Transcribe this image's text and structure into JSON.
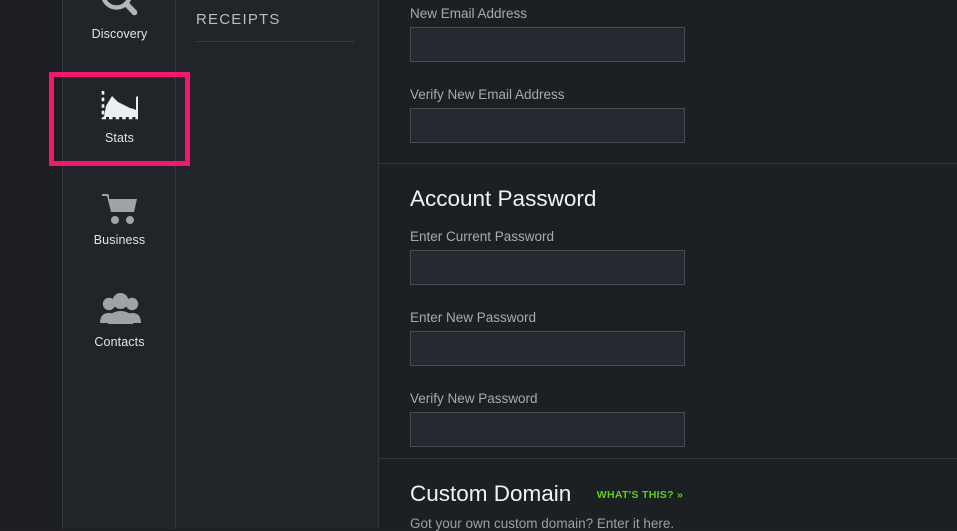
{
  "theme": {
    "page_bg": "#1e2024",
    "panel_bg": "#212428",
    "content_bg": "#1d2023",
    "divider": "#34383d",
    "highlight_pink": "#f5176e",
    "accent_green": "#5bce1f",
    "label_gray": "#a6abb0",
    "heading_white": "#f2f2f2"
  },
  "sidebar": {
    "items": [
      {
        "id": "discovery",
        "label": "Discovery",
        "icon": "magnifier-icon",
        "selected": false
      },
      {
        "id": "stats",
        "label": "Stats",
        "icon": "area-chart-icon",
        "selected": true
      },
      {
        "id": "business",
        "label": "Business",
        "icon": "shopping-cart-icon",
        "selected": false
      },
      {
        "id": "contacts",
        "label": "Contacts",
        "icon": "people-group-icon",
        "selected": false
      }
    ],
    "highlighted_item": "Stats"
  },
  "middle_column": {
    "heading": "RECEIPTS"
  },
  "content": {
    "sections": [
      {
        "id": "email",
        "title": "",
        "fields": [
          {
            "label": "New Email Address",
            "value": "",
            "placeholder": ""
          },
          {
            "label": "Verify New Email Address",
            "value": "",
            "placeholder": ""
          }
        ]
      },
      {
        "id": "password",
        "title": "Account Password",
        "fields": [
          {
            "label": "Enter Current Password",
            "value": "",
            "placeholder": ""
          },
          {
            "label": "Enter New Password",
            "value": "",
            "placeholder": ""
          },
          {
            "label": "Verify New Password",
            "value": "",
            "placeholder": ""
          }
        ]
      },
      {
        "id": "domain",
        "title": "Custom Domain",
        "help_link": "WHAT'S THIS? »",
        "subtitle": "Got your own custom domain? Enter it here."
      }
    ]
  }
}
